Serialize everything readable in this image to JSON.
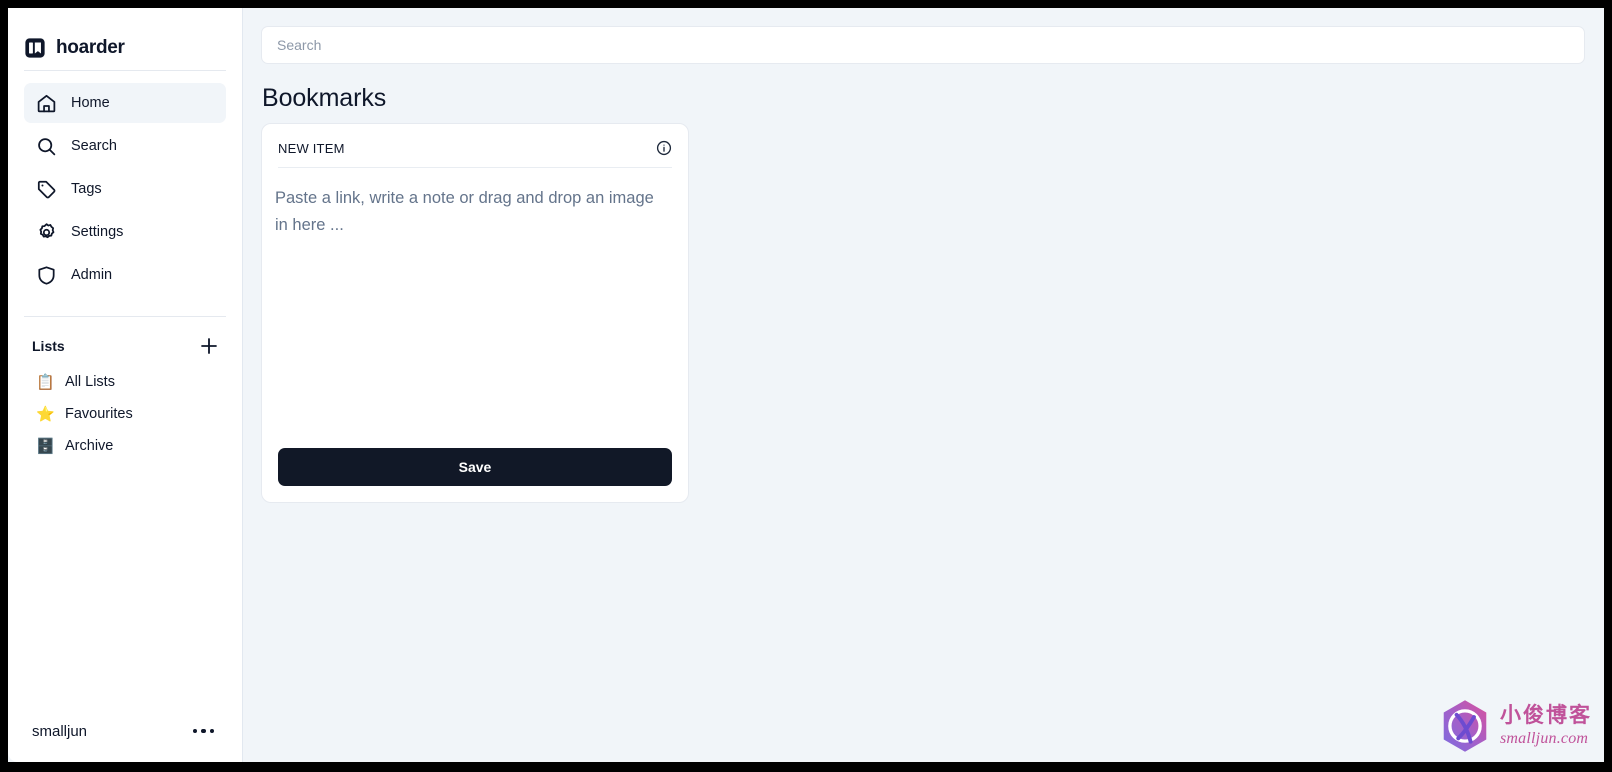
{
  "brand": {
    "name": "hoarder",
    "logo_icon": "book-square-icon"
  },
  "sidebar": {
    "nav": [
      {
        "label": "Home",
        "icon": "home-icon",
        "active": true
      },
      {
        "label": "Search",
        "icon": "search-icon",
        "active": false
      },
      {
        "label": "Tags",
        "icon": "tag-icon",
        "active": false
      },
      {
        "label": "Settings",
        "icon": "gear-icon",
        "active": false
      },
      {
        "label": "Admin",
        "icon": "shield-icon",
        "active": false
      }
    ],
    "lists": {
      "title": "Lists",
      "add_icon": "plus-icon",
      "items": [
        {
          "label": "All Lists",
          "emoji": "📋",
          "icon": "clipboard-icon"
        },
        {
          "label": "Favourites",
          "emoji": "⭐",
          "icon": "star-icon"
        },
        {
          "label": "Archive",
          "emoji": "🗄️",
          "icon": "file-cabinet-icon"
        }
      ]
    },
    "user": {
      "name": "smalljun",
      "menu_icon": "ellipsis-icon"
    }
  },
  "main": {
    "search": {
      "value": "",
      "placeholder": "Search"
    },
    "page_title": "Bookmarks",
    "card": {
      "title": "NEW ITEM",
      "info_icon": "info-circle-icon",
      "editor_placeholder": "Paste a link, write a note or drag and drop an image in here ...",
      "editor_value": "",
      "save_label": "Save"
    }
  },
  "watermark": {
    "cn_text": "小俊博客",
    "en_text": "smalljun.com",
    "logo_icon": "hexagon-x-logo-icon"
  },
  "colors": {
    "accent_dark": "#111827",
    "page_bg": "#f1f5f9",
    "sidebar_bg": "#ffffff",
    "border": "#e2e8f0",
    "muted_text": "#64748b",
    "watermark_pink": "#c0529a",
    "watermark_purple": "#8b5cf6"
  }
}
